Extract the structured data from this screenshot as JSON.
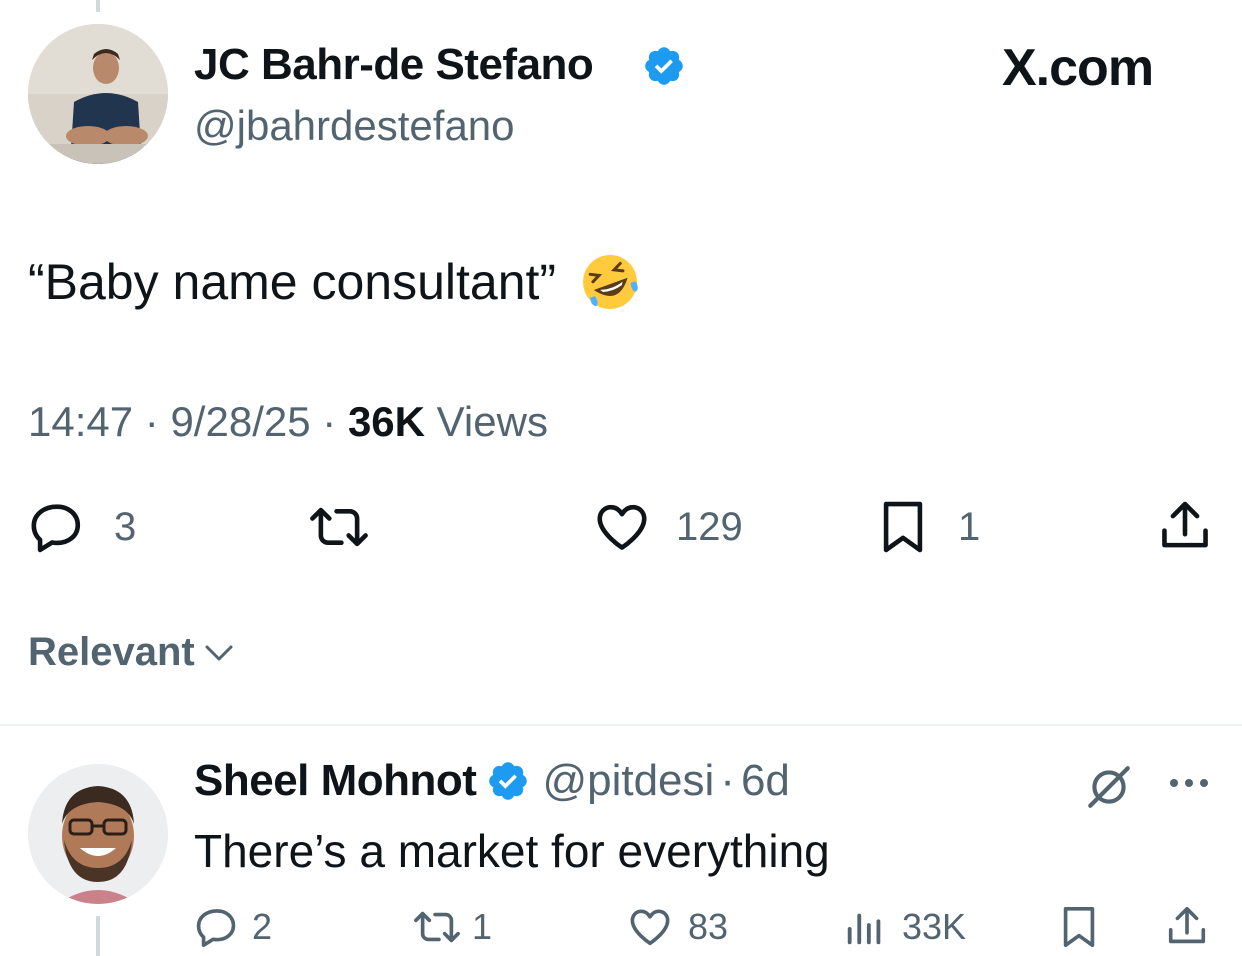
{
  "main_tweet": {
    "author_name": "JC Bahr-de Stefano",
    "handle": "@jbahrdestefano",
    "source": "X.com",
    "text": "“Baby name consultant”",
    "time": "14:47",
    "date": "9/28/25",
    "views_count": "36K",
    "views_label": "Views",
    "sep": "·",
    "actions": {
      "replies": "3",
      "reposts": "",
      "likes": "129",
      "bookmarks": "1"
    }
  },
  "sort": {
    "label": "Relevant"
  },
  "reply": {
    "author_name": "Sheel Mohnot",
    "handle": "@pitdesi",
    "sep": "·",
    "age": "6d",
    "text": "There’s a market for everything",
    "actions": {
      "replies": "2",
      "reposts": "1",
      "likes": "83",
      "views": "33K"
    }
  },
  "colors": {
    "verified": "#1d9bf0",
    "muted": "#536471",
    "text": "#0f1419",
    "divider": "#eff3f4"
  },
  "icons": [
    "verified-badge-icon",
    "reply-icon",
    "repost-icon",
    "like-icon",
    "bookmark-icon",
    "share-icon",
    "chevron-down-icon",
    "grok-icon",
    "more-icon",
    "views-icon",
    "laughing-emoji-icon"
  ]
}
